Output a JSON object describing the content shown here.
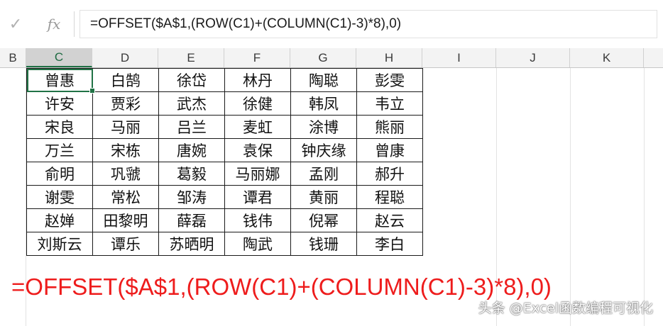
{
  "formula_bar": {
    "check_icon": "✓",
    "fx_label": "fx",
    "formula": "=OFFSET($A$1,(ROW(C1)+(COLUMN(C1)-3)*8),0)"
  },
  "columns": [
    "B",
    "C",
    "D",
    "E",
    "F",
    "G",
    "H",
    "I",
    "J",
    "K"
  ],
  "selected_column": "C",
  "table": {
    "rows": [
      [
        "曾惠",
        "白鹄",
        "徐岱",
        "林丹",
        "陶聪",
        "彭雯"
      ],
      [
        "许安",
        "贾彩",
        "武杰",
        "徐健",
        "韩凤",
        "韦立"
      ],
      [
        "宋良",
        "马丽",
        "吕兰",
        "麦虹",
        "涂博",
        "熊丽"
      ],
      [
        "万兰",
        "宋栋",
        "唐婉",
        "袁保",
        "钟庆缘",
        "曾康"
      ],
      [
        "俞明",
        "巩虢",
        "葛毅",
        "马丽娜",
        "孟刚",
        "郝升"
      ],
      [
        "谢雯",
        "常松",
        "邹涛",
        "谭君",
        "黄丽",
        "程聪"
      ],
      [
        "赵婵",
        "田黎明",
        "薛磊",
        "钱伟",
        "倪幂",
        "赵云"
      ],
      [
        "刘斯云",
        "谭乐",
        "苏晒明",
        "陶武",
        "钱珊",
        "李白"
      ]
    ]
  },
  "annotation": "=OFFSET($A$1,(ROW(C1)+(COLUMN(C1)-3)*8),0)",
  "watermark": "头条 @Excel函数编程可视化",
  "colors": {
    "accent": "#217346",
    "annotation": "#ee1c1c"
  }
}
